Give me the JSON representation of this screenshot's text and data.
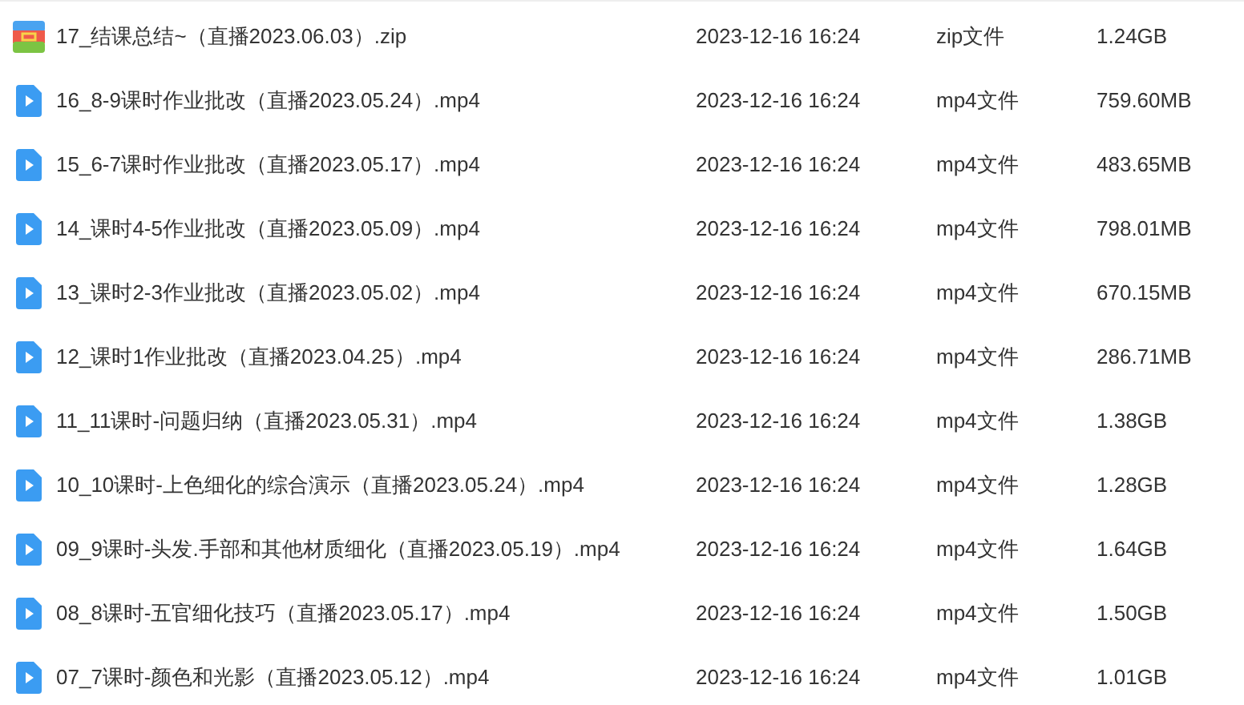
{
  "files": [
    {
      "kind": "zip",
      "name": "17_结课总结~（直播2023.06.03）.zip",
      "modified": "2023-12-16 16:24",
      "type": "zip文件",
      "size": "1.24GB"
    },
    {
      "kind": "video",
      "name": "16_8-9课时作业批改（直播2023.05.24）.mp4",
      "modified": "2023-12-16 16:24",
      "type": "mp4文件",
      "size": "759.60MB"
    },
    {
      "kind": "video",
      "name": "15_6-7课时作业批改（直播2023.05.17）.mp4",
      "modified": "2023-12-16 16:24",
      "type": "mp4文件",
      "size": "483.65MB"
    },
    {
      "kind": "video",
      "name": "14_课时4-5作业批改（直播2023.05.09）.mp4",
      "modified": "2023-12-16 16:24",
      "type": "mp4文件",
      "size": "798.01MB"
    },
    {
      "kind": "video",
      "name": "13_课时2-3作业批改（直播2023.05.02）.mp4",
      "modified": "2023-12-16 16:24",
      "type": "mp4文件",
      "size": "670.15MB"
    },
    {
      "kind": "video",
      "name": "12_课时1作业批改（直播2023.04.25）.mp4",
      "modified": "2023-12-16 16:24",
      "type": "mp4文件",
      "size": "286.71MB"
    },
    {
      "kind": "video",
      "name": "11_11课时-问题归纳（直播2023.05.31）.mp4",
      "modified": "2023-12-16 16:24",
      "type": "mp4文件",
      "size": "1.38GB"
    },
    {
      "kind": "video",
      "name": "10_10课时-上色细化的综合演示（直播2023.05.24）.mp4",
      "modified": "2023-12-16 16:24",
      "type": "mp4文件",
      "size": "1.28GB"
    },
    {
      "kind": "video",
      "name": "09_9课时-头发.手部和其他材质细化（直播2023.05.19）.mp4",
      "modified": "2023-12-16 16:24",
      "type": "mp4文件",
      "size": "1.64GB"
    },
    {
      "kind": "video",
      "name": "08_8课时-五官细化技巧（直播2023.05.17）.mp4",
      "modified": "2023-12-16 16:24",
      "type": "mp4文件",
      "size": "1.50GB"
    },
    {
      "kind": "video",
      "name": "07_7课时-颜色和光影（直播2023.05.12）.mp4",
      "modified": "2023-12-16 16:24",
      "type": "mp4文件",
      "size": "1.01GB"
    }
  ]
}
